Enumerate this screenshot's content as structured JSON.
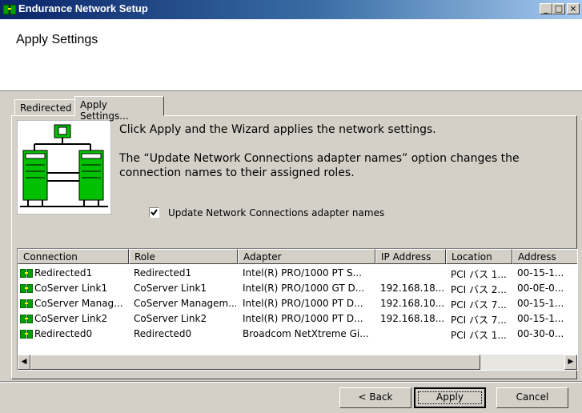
{
  "window": {
    "title": "Endurance Network Setup",
    "minimize": "_",
    "maximize": "□",
    "close": "×"
  },
  "header": {
    "page_title": "Apply Settings"
  },
  "tabs": [
    {
      "label": "Redirected"
    },
    {
      "label": "Apply Settings..."
    }
  ],
  "description": {
    "line1": "Click Apply and the Wizard applies the network settings.",
    "line2": "The “Update Network Connections adapter names” option changes the",
    "line3": "connection names to their assigned roles."
  },
  "option": {
    "label": "Update Network Connections adapter names",
    "checked": true
  },
  "table": {
    "columns": [
      "Connection",
      "Role",
      "Adapter",
      "IP Address",
      "Location",
      "Address"
    ],
    "rows": [
      [
        "Redirected1",
        "Redirected1",
        "Intel(R) PRO/1000 PT S...",
        "",
        "PCI バス 1...",
        "00-15-1..."
      ],
      [
        "CoServer Link1",
        "CoServer Link1",
        "Intel(R) PRO/1000 GT D...",
        "192.168.18...",
        "PCI バス 2...",
        "00-0E-0..."
      ],
      [
        "CoServer Manag...",
        "CoServer Managem...",
        "Intel(R) PRO/1000 PT D...",
        "192.168.10...",
        "PCI バス 7...",
        "00-15-1..."
      ],
      [
        "CoServer Link2",
        "CoServer Link2",
        "Intel(R) PRO/1000 PT D...",
        "192.168.18...",
        "PCI バス 7...",
        "00-15-1..."
      ],
      [
        "Redirected0",
        "Redirected0",
        "Broadcom NetXtreme Gi...",
        "",
        "PCI バス 1...",
        "00-30-0..."
      ]
    ]
  },
  "buttons": {
    "back": "< Back",
    "apply": "Apply",
    "cancel": "Cancel"
  },
  "icons": {
    "app": "network-icon",
    "row": "network-adapter-icon"
  },
  "colors": {
    "titlebar_start": "#0a246a",
    "titlebar_end": "#a6caf0",
    "face": "#d4d0c8",
    "illustration_green": "#00c000"
  }
}
